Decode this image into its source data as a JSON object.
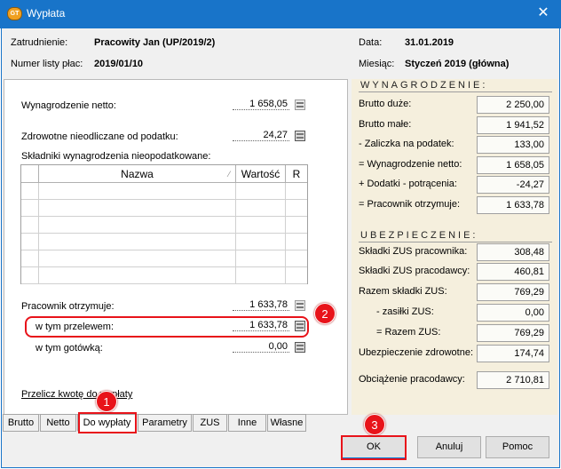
{
  "window": {
    "title": "Wypłata",
    "app_icon_text": "GT"
  },
  "header": {
    "employment_label": "Zatrudnienie:",
    "employment_value": "Pracowity Jan (UP/2019/2)",
    "list_label": "Numer listy płac:",
    "list_value": "2019/01/10",
    "date_label": "Data:",
    "date_value": "31.01.2019",
    "month_label": "Miesiąc:",
    "month_value": "Styczeń 2019 (główna)"
  },
  "left": {
    "net_label": "Wynagrodzenie netto:",
    "net_value": "1 658,05",
    "health_label": "Zdrowotne nieodliczane od podatku:",
    "health_value": "24,27",
    "untaxed_label": "Składniki wynagrodzenia nieopodatkowane:",
    "grid_headers": {
      "name": "Nazwa",
      "value": "Wartość",
      "r": "R"
    },
    "employee_receives_label": "Pracownik otrzymuje:",
    "employee_receives_value": "1 633,78",
    "transfer_label": "w tym przelewem:",
    "transfer_value": "1 633,78",
    "cash_label": "w tym gotówką:",
    "cash_value": "0,00",
    "recalc_link": "Przelicz kwotę do wypłaty"
  },
  "right": {
    "salary_section": "WYNAGRODZENIE:",
    "rows": [
      {
        "label": "Brutto duże:",
        "value": "2 250,00"
      },
      {
        "label": "Brutto małe:",
        "value": "1 941,52"
      },
      {
        "label": "- Zaliczka na podatek:",
        "value": "133,00"
      },
      {
        "label": "= Wynagrodzenie netto:",
        "value": "1 658,05"
      },
      {
        "label": "+ Dodatki - potrącenia:",
        "value": "-24,27"
      },
      {
        "label": "= Pracownik otrzymuje:",
        "value": "1 633,78"
      }
    ],
    "insurance_section": "UBEZPIECZENIE:",
    "ins_rows": [
      {
        "label": "Składki ZUS pracownika:",
        "value": "308,48"
      },
      {
        "label": "Składki ZUS pracodawcy:",
        "value": "460,81"
      },
      {
        "label": "Razem składki ZUS:",
        "value": "769,29"
      },
      {
        "label": "- zasiłki ZUS:",
        "value": "0,00"
      },
      {
        "label": "= Razem ZUS:",
        "value": "769,29"
      },
      {
        "label": "Ubezpieczenie zdrowotne:",
        "value": "174,74"
      },
      {
        "label": "Obciążenie pracodawcy:",
        "value": "2 710,81"
      }
    ]
  },
  "tabs": [
    "Brutto",
    "Netto",
    "Do wypłaty",
    "Parametry",
    "ZUS",
    "Inne",
    "Własne"
  ],
  "active_tab": "Do wypłaty",
  "buttons": {
    "ok": "OK",
    "cancel": "Anuluj",
    "help": "Pomoc"
  },
  "annotations": {
    "one": "1",
    "two": "2",
    "three": "3"
  },
  "colors": {
    "titlebar": "#1874c9",
    "accent_red": "#e8131a",
    "right_panel_bg": "#f5efdd"
  }
}
